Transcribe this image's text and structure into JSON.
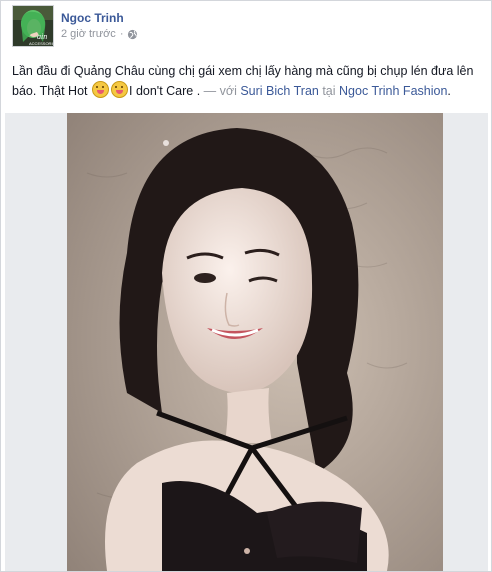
{
  "post": {
    "author": "Ngoc Trinh",
    "time": "2 giờ trước",
    "privacy_icon": "globe-icon",
    "text_main": "Lần đầu đi Quảng Châu cùng chị gái xem chị lấy hàng mà cũng bị chụp lén đưa lên báo. Thật Hot",
    "text_after_emoji": "I don't Care .",
    "with_prefix": " — với ",
    "tagged_person": "Suri Bich Tran",
    "at_prefix": " tại ",
    "location": "Ngoc Trinh Fashion",
    "end_punct": "."
  },
  "colors": {
    "link": "#3b5998",
    "muted": "#90949c",
    "photo_bg": "#e9ebee"
  }
}
